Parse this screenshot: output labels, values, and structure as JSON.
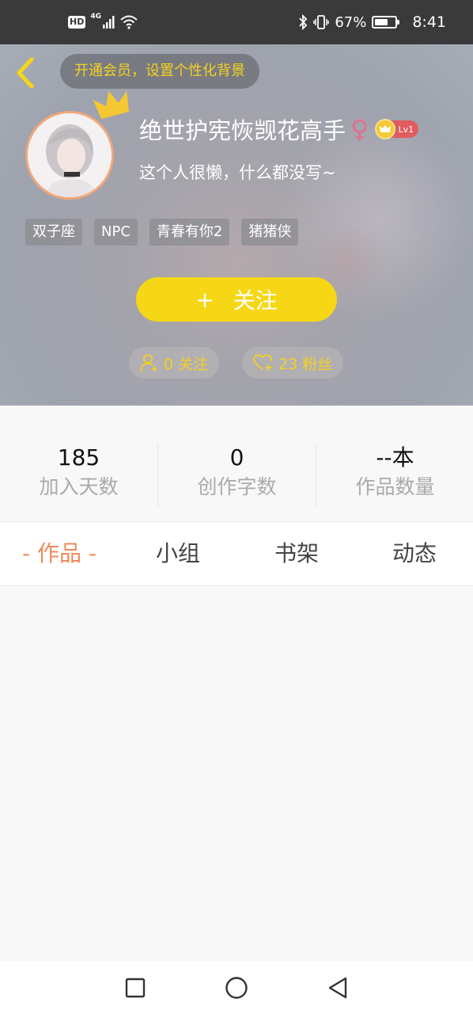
{
  "status_bar": {
    "hd": "HD",
    "network": "4G",
    "battery_percent_text": "67%",
    "battery_level": 0.67,
    "time": "8:41",
    "icons": [
      "signal-icon",
      "wifi-icon",
      "bluetooth-icon",
      "vibrate-icon",
      "battery-icon"
    ]
  },
  "header": {
    "vip_banner": "开通会员，设置个性化背景",
    "username": "绝世护宪恢觊花高手",
    "gender_symbol": "♀",
    "level": "Lv1",
    "bio": "这个人很懒，什么都没写~",
    "tags": [
      "双子座",
      "NPC",
      "青春有你2",
      "猪猪侠"
    ],
    "follow_plus": "+",
    "follow_label": "关注",
    "following_text": "0 关注",
    "fans_text": "23 粉丝"
  },
  "stats": [
    {
      "value": "185",
      "label": "加入天数"
    },
    {
      "value": "0",
      "label": "创作字数"
    },
    {
      "value": "--本",
      "label": "作品数量"
    }
  ],
  "tabs": [
    {
      "label": "- 作品 -",
      "active": true
    },
    {
      "label": "小组",
      "active": false
    },
    {
      "label": "书架",
      "active": false
    },
    {
      "label": "动态",
      "active": false
    }
  ],
  "colors": {
    "accent_yellow": "#f6d716",
    "tab_active": "#ee8a5a",
    "avatar_border": "#f1a77a",
    "gender_pink": "#e36f8e",
    "level_red": "#e25b5f"
  }
}
